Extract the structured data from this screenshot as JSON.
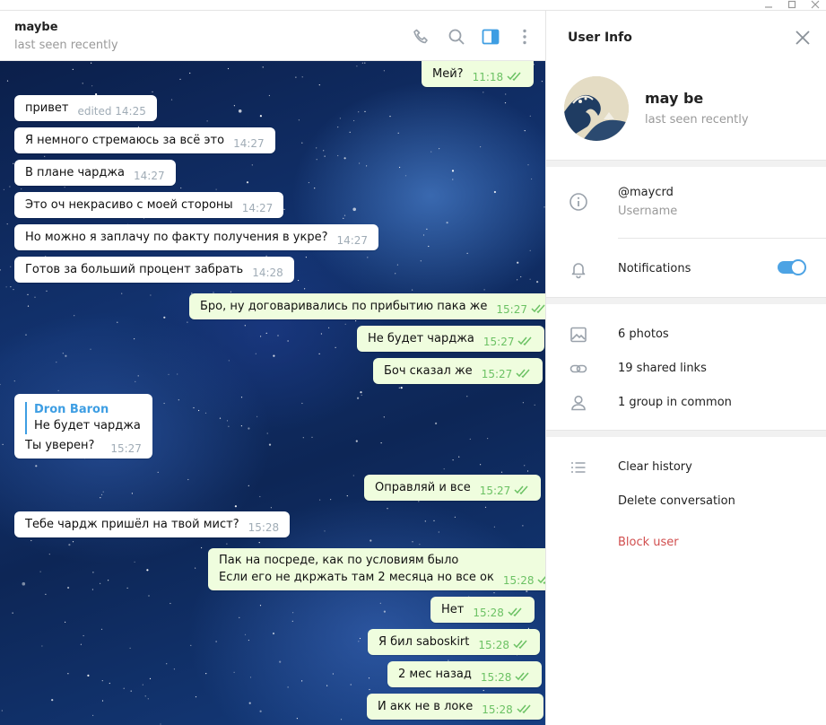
{
  "colors": {
    "accent": "#4da3e4",
    "outgoing_bubble": "#effdde",
    "incoming_bubble": "#ffffff",
    "danger": "#d14e4e",
    "read_check": "#6cc264"
  },
  "chat_header": {
    "title": "maybe",
    "status": "last seen recently",
    "icons": [
      "phone-icon",
      "search-icon",
      "sidebar-toggle-icon",
      "more-vertical-icon"
    ]
  },
  "messages": [
    {
      "dir": "out",
      "text": "Мей?",
      "time": "11:18"
    },
    {
      "dir": "in",
      "text": "привет",
      "time": "edited 14:25"
    },
    {
      "dir": "in",
      "text": "Я немного стремаюсь за всё это",
      "time": "14:27"
    },
    {
      "dir": "in",
      "text": "В плане чарджа",
      "time": "14:27"
    },
    {
      "dir": "in",
      "text": "Это оч некрасиво с моей стороны",
      "time": "14:27"
    },
    {
      "dir": "in",
      "text": "Но можно я заплачу по факту получения в укре?",
      "time": "14:27"
    },
    {
      "dir": "in",
      "text": "Готов за больший процент забрать",
      "time": "14:28"
    },
    {
      "dir": "out",
      "text": "Бро, ну договаривались по прибытию пака же",
      "time": "15:27"
    },
    {
      "dir": "out",
      "text": "Не будет чарджа",
      "time": "15:27"
    },
    {
      "dir": "out",
      "text": "Боч сказал же",
      "time": "15:27"
    },
    {
      "dir": "in",
      "reply_name": "Dron Baron",
      "reply_text": "Не будет чарджа",
      "text": "Ты уверен?",
      "time": "15:27"
    },
    {
      "dir": "out",
      "text": "Оправляй и все",
      "time": "15:27"
    },
    {
      "dir": "in",
      "text": "Тебе чардж пришёл на твой мист?",
      "time": "15:28"
    },
    {
      "dir": "out",
      "text": "Пак на посреде, как по условиям было",
      "text2": "Если его не дкржать там 2 месяца но все ок",
      "time": "15:28"
    },
    {
      "dir": "out",
      "text": "Нет",
      "time": "15:28"
    },
    {
      "dir": "out",
      "text": "Я бил saboskirt",
      "time": "15:28"
    },
    {
      "dir": "out",
      "text": "2 мес назад",
      "time": "15:28"
    },
    {
      "dir": "out",
      "text": "И акк не в локе",
      "time": "15:28"
    }
  ],
  "user_info": {
    "title": "User Info",
    "name": "may be",
    "status": "last seen recently",
    "username": "@maycrd",
    "username_label": "Username",
    "notifications_label": "Notifications",
    "notifications_on": true,
    "photos": "6 photos",
    "shared_links": "19 shared links",
    "groups": "1 group in common",
    "clear_history": "Clear history",
    "delete_conversation": "Delete conversation",
    "block_user": "Block user"
  }
}
